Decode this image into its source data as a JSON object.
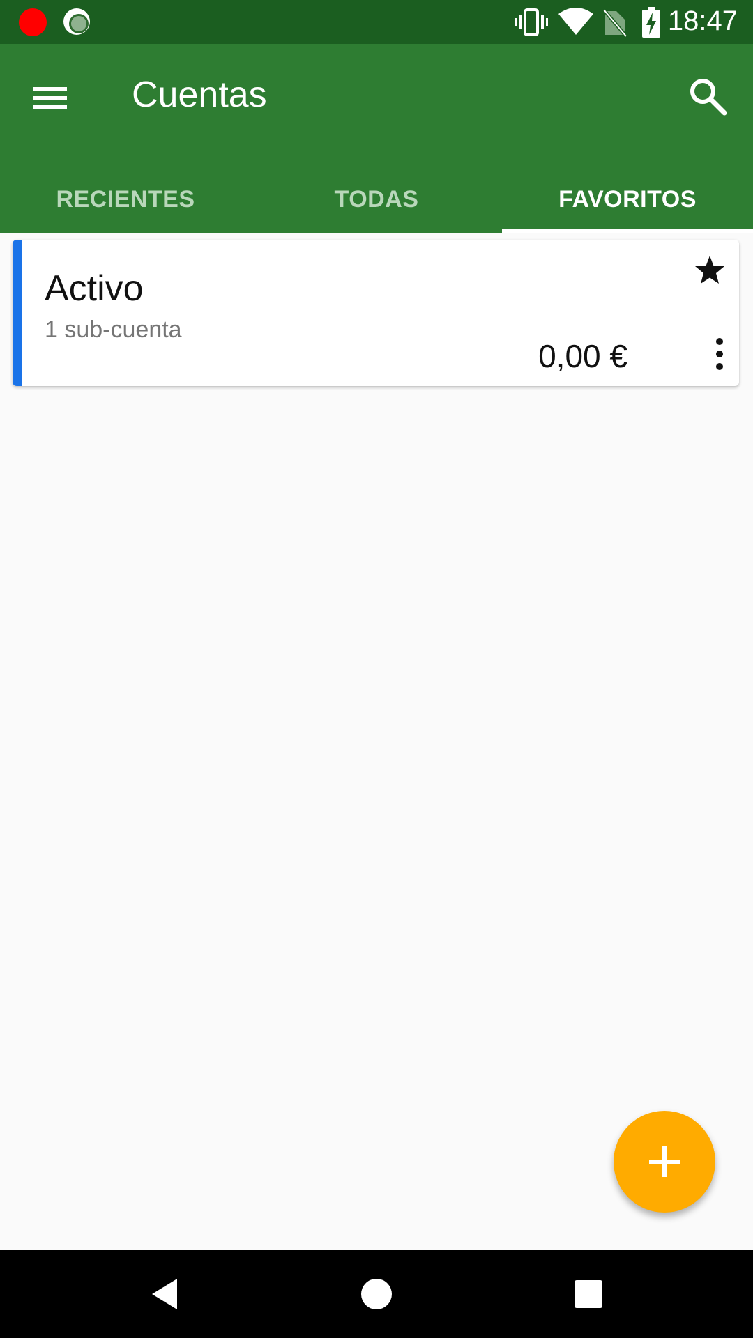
{
  "status_bar": {
    "time": "18:47",
    "icons": [
      "record-dot",
      "screen-record-icon",
      "vibrate-icon",
      "wifi-icon",
      "no-sim-icon",
      "battery-charging-icon"
    ],
    "record_color": "#ff0000"
  },
  "app_bar": {
    "title": "Cuentas",
    "menu_icon": "menu-icon",
    "search_icon": "search-icon"
  },
  "tabs": [
    {
      "label": "RECIENTES",
      "active": false
    },
    {
      "label": "TODAS",
      "active": false
    },
    {
      "label": "FAVORITOS",
      "active": true
    }
  ],
  "accounts": [
    {
      "name": "Activo",
      "subaccounts": "1 sub-cuenta",
      "balance": "0,00 €",
      "favorite": true,
      "color": "#1a73e8"
    }
  ],
  "fab": {
    "icon": "plus-icon",
    "color": "#ffab00"
  },
  "nav_bar": {
    "icons": [
      "back-icon",
      "home-icon",
      "recents-icon"
    ]
  }
}
